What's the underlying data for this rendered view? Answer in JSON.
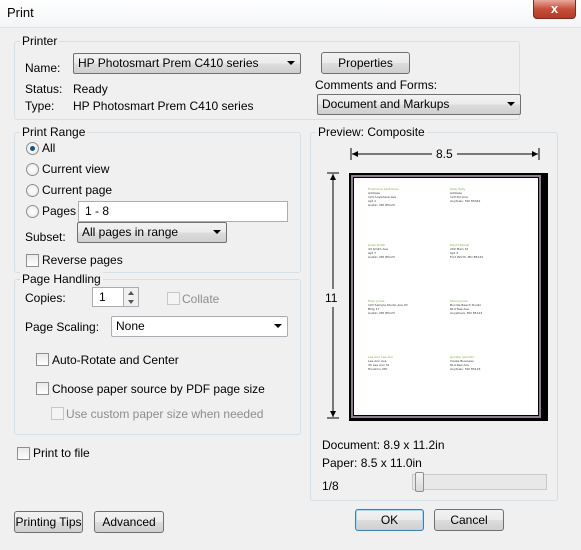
{
  "window": {
    "title": "Print",
    "close_glyph": "x"
  },
  "printer": {
    "group_label": "Printer",
    "name_label": "Name:",
    "name_value": "HP Photosmart Prem C410 series",
    "properties_button": "Properties",
    "status_label": "Status:",
    "status_value": "Ready",
    "type_label": "Type:",
    "type_value": "HP Photosmart Prem C410 series",
    "comments_label": "Comments and Forms:",
    "comments_value": "Document and Markups"
  },
  "print_range": {
    "group_label": "Print Range",
    "options": [
      {
        "label": "All",
        "checked": true
      },
      {
        "label": "Current view",
        "checked": false
      },
      {
        "label": "Current page",
        "checked": false
      },
      {
        "label": "Pages",
        "checked": false
      }
    ],
    "pages_value": "1 - 8",
    "subset_label": "Subset:",
    "subset_value": "All pages in range",
    "reverse_pages_label": "Reverse pages"
  },
  "page_handling": {
    "group_label": "Page Handling",
    "copies_label": "Copies:",
    "copies_value": "1",
    "collate_label": "Collate",
    "scaling_label": "Page Scaling:",
    "scaling_value": "None",
    "auto_rotate_label": "Auto-Rotate and Center",
    "paper_source_label": "Choose paper source by PDF page size",
    "custom_paper_label": "Use custom paper size when needed"
  },
  "print_to_file_label": "Print to file",
  "preview": {
    "group_label": "Preview: Composite",
    "width_label": "8.5",
    "height_label": "11",
    "document_size": "Document: 8.9 x 11.2in",
    "paper_size": "Paper: 8.5 x 11.0in",
    "page_indicator": "1/8",
    "slider_position": 0.02,
    "labels": [
      {
        "name": "Firstname Lastname",
        "lines": [
          "Address",
          "123 Anywhere Ave",
          "Apt 1",
          "Austin, MO 85123"
        ]
      },
      {
        "name": "Sally Kelly",
        "lines": [
          "Address",
          "123 Rd Line",
          "Anytown, MO 85342"
        ]
      },
      {
        "name": "Janet Smith",
        "lines": [
          "44 Smith Ave",
          "Apt 7",
          "Austin, MO 85123"
        ]
      },
      {
        "name": "David Daniel",
        "lines": [
          "200 Main St",
          "Apt 3",
          "Fort Worth, MO 85132"
        ]
      },
      {
        "name": "Evan Jones",
        "lines": [
          "103 Sample Studio Ave 03",
          "Bldg 17",
          "Austin, MO 85123"
        ]
      },
      {
        "name": "Steve Jones",
        "lines": [
          "Bundle Beach Studio",
          "814 Teal Ave",
          "Anywhere, MO 85123"
        ]
      },
      {
        "name": "Lee Ann Lee Ann",
        "lines": [
          "Lee Ann Ave",
          "30 Lee Ann St",
          "Houston, MO"
        ]
      },
      {
        "name": "Jennifer Jennifer",
        "lines": [
          "Clarke Business",
          "814 Red Ave",
          "Anytown, MO 85123"
        ]
      }
    ]
  },
  "buttons": {
    "printing_tips": "Printing Tips",
    "advanced": "Advanced",
    "ok": "OK",
    "cancel": "Cancel"
  }
}
